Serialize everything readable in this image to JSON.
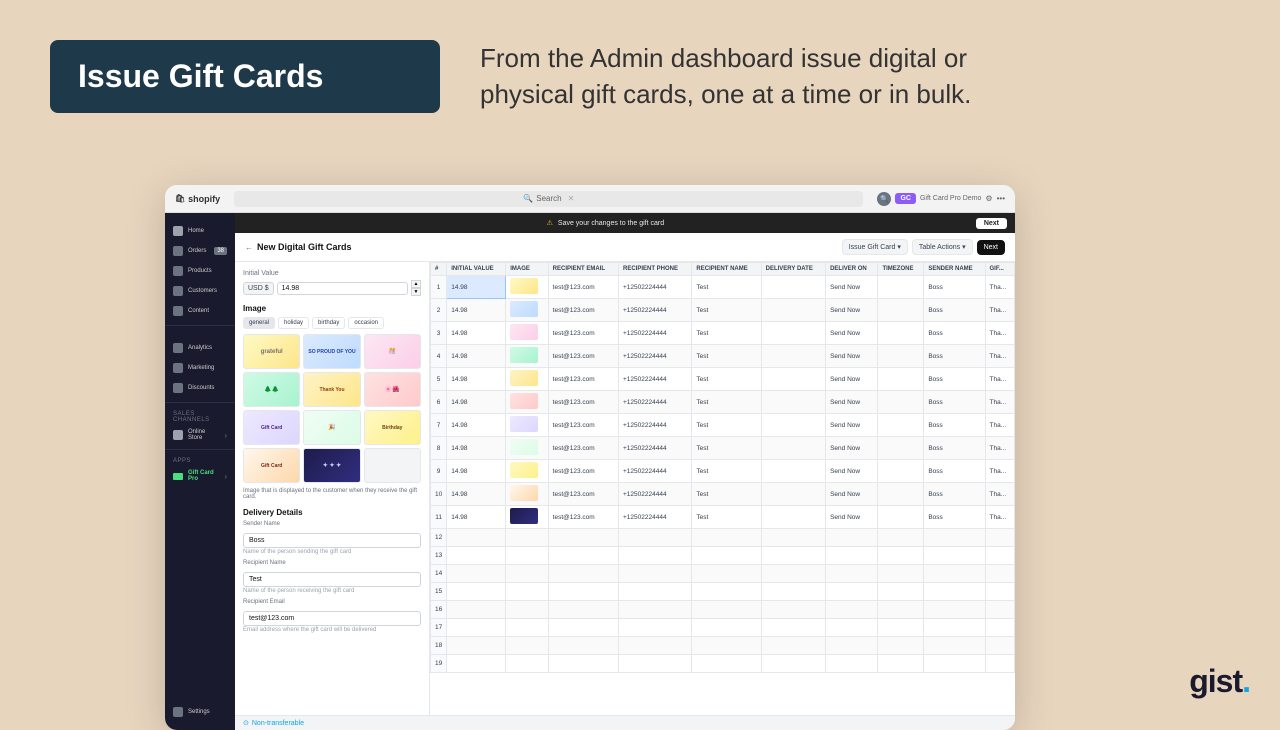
{
  "page": {
    "background_color": "#e8d5be"
  },
  "header": {
    "title": "Issue Gift Cards",
    "subtitle": "From the Admin dashboard issue digital\nor physical gift cards, one at a time or in bulk."
  },
  "browser": {
    "address_bar_text": "Search",
    "store_name": "Gift Card Pro Demo"
  },
  "sidebar": {
    "items": [
      {
        "label": "Home",
        "icon": "home-icon"
      },
      {
        "label": "Orders",
        "icon": "orders-icon",
        "badge": "38"
      },
      {
        "label": "Products",
        "icon": "products-icon"
      },
      {
        "label": "Customers",
        "icon": "customers-icon"
      },
      {
        "label": "Content",
        "icon": "content-icon"
      }
    ],
    "analytics_items": [
      {
        "label": "Analytics"
      },
      {
        "label": "Marketing"
      },
      {
        "label": "Discounts"
      }
    ],
    "sales_channels": {
      "label": "Sales channels",
      "items": [
        {
          "label": "Online Store"
        }
      ]
    },
    "apps": {
      "label": "Apps",
      "items": [
        {
          "label": "Gift Card Pro",
          "active": true
        }
      ]
    },
    "bottom_items": [
      {
        "label": "Settings"
      }
    ]
  },
  "top_bar": {
    "save_notice": "Save your changes to the gift card",
    "next_button": "Next"
  },
  "page_content": {
    "back_label": "←",
    "page_title": "New Digital Gift Cards",
    "actions": [
      {
        "label": "Issue Gift Card ▾"
      },
      {
        "label": "Table Actions ▾"
      },
      {
        "label": "Next",
        "primary": true
      }
    ]
  },
  "left_panel": {
    "initial_value_label": "Initial Value",
    "currency": "USD $",
    "initial_value": "14.98",
    "image_section_label": "Image",
    "image_tabs": [
      "general",
      "holiday",
      "birthday",
      "occasion"
    ],
    "image_cards": [
      {
        "label": "grateful",
        "style": "grateful"
      },
      {
        "label": "SO PROUD OF YOU",
        "style": "proud"
      },
      {
        "label": "🎊",
        "style": "congrats"
      },
      {
        "label": "🌲🌲",
        "style": "trees"
      },
      {
        "label": "Thank You",
        "style": "thankyou"
      },
      {
        "label": "🌸🌺",
        "style": "flowers"
      },
      {
        "label": "Gift Card",
        "style": "giftcard"
      },
      {
        "label": "🎉",
        "style": "dots"
      },
      {
        "label": "Birthday",
        "style": "birthday"
      },
      {
        "label": "Gift Card",
        "style": "giftcard2"
      },
      {
        "label": "✦ ✦ ✦",
        "style": "dark-dots"
      },
      {
        "label": "",
        "style": ""
      }
    ],
    "image_description": "Image that is displayed to the customer when they receive the gift card.",
    "delivery_section_label": "Delivery Details",
    "fields": [
      {
        "label": "Sender Name",
        "value": "Boss",
        "hint": "Name of the person sending the gift card"
      },
      {
        "label": "Recipient Name",
        "value": "Test",
        "hint": "Name of the person receiving the gift card"
      },
      {
        "label": "Recipient Email",
        "value": "test@123.com",
        "hint": "Email address where the gift card will be delivered"
      }
    ]
  },
  "spreadsheet": {
    "headers": [
      "#",
      "INITIAL VALUE",
      "IMAGE",
      "RECIPIENT EMAIL",
      "RECIPIENT PHONE",
      "RECIPIENT NAME",
      "DELIVERY DATE",
      "DELIVER ON",
      "TIMEZONE",
      "SENDER NAME",
      "GIF..."
    ],
    "rows": [
      {
        "num": 1,
        "value": "14.98",
        "email": "test@123.com",
        "phone": "+12502224444",
        "name": "Test",
        "deliver_on": "Send Now",
        "sender": "Boss",
        "gift": "Tha..."
      },
      {
        "num": 2,
        "value": "14.98",
        "email": "test@123.com",
        "phone": "+12502224444",
        "name": "Test",
        "deliver_on": "Send Now",
        "sender": "Boss",
        "gift": "Tha..."
      },
      {
        "num": 3,
        "value": "14.98",
        "email": "test@123.com",
        "phone": "+12502224444",
        "name": "Test",
        "deliver_on": "Send Now",
        "sender": "Boss",
        "gift": "Tha..."
      },
      {
        "num": 4,
        "value": "14.98",
        "email": "test@123.com",
        "phone": "+12502224444",
        "name": "Test",
        "deliver_on": "Send Now",
        "sender": "Boss",
        "gift": "Tha..."
      },
      {
        "num": 5,
        "value": "14.98",
        "email": "test@123.com",
        "phone": "+12502224444",
        "name": "Test",
        "deliver_on": "Send Now",
        "sender": "Boss",
        "gift": "Tha..."
      },
      {
        "num": 6,
        "value": "14.98",
        "email": "test@123.com",
        "phone": "+12502224444",
        "name": "Test",
        "deliver_on": "Send Now",
        "sender": "Boss",
        "gift": "Tha..."
      },
      {
        "num": 7,
        "value": "14.98",
        "email": "test@123.com",
        "phone": "+12502224444",
        "name": "Test",
        "deliver_on": "Send Now",
        "sender": "Boss",
        "gift": "Tha..."
      },
      {
        "num": 8,
        "value": "14.98",
        "email": "test@123.com",
        "phone": "+12502224444",
        "name": "Test",
        "deliver_on": "Send Now",
        "sender": "Boss",
        "gift": "Tha..."
      },
      {
        "num": 9,
        "value": "14.98",
        "email": "test@123.com",
        "phone": "+12502224444",
        "name": "Test",
        "deliver_on": "Send Now",
        "sender": "Boss",
        "gift": "Tha..."
      },
      {
        "num": 10,
        "value": "14.98",
        "email": "test@123.com",
        "phone": "+12502224444",
        "name": "Test",
        "deliver_on": "Send Now",
        "sender": "Boss",
        "gift": "Tha..."
      },
      {
        "num": 11,
        "value": "14.98",
        "email": "test@123.com",
        "phone": "+12502224444",
        "name": "Test",
        "deliver_on": "Send Now",
        "sender": "Boss",
        "gift": "Tha..."
      },
      {
        "num": 12,
        "value": "",
        "email": "",
        "phone": "",
        "name": "",
        "deliver_on": "",
        "sender": "",
        "gift": ""
      },
      {
        "num": 13,
        "value": "",
        "email": "",
        "phone": "",
        "name": "",
        "deliver_on": "",
        "sender": "",
        "gift": ""
      },
      {
        "num": 14,
        "value": "",
        "email": "",
        "phone": "",
        "name": "",
        "deliver_on": "",
        "sender": "",
        "gift": ""
      },
      {
        "num": 15,
        "value": "",
        "email": "",
        "phone": "",
        "name": "",
        "deliver_on": "",
        "sender": "",
        "gift": ""
      },
      {
        "num": 16,
        "value": "",
        "email": "",
        "phone": "",
        "name": "",
        "deliver_on": "",
        "sender": "",
        "gift": ""
      },
      {
        "num": 17,
        "value": "",
        "email": "",
        "phone": "",
        "name": "",
        "deliver_on": "",
        "sender": "",
        "gift": ""
      },
      {
        "num": 18,
        "value": "",
        "email": "",
        "phone": "",
        "name": "",
        "deliver_on": "",
        "sender": "",
        "gift": ""
      },
      {
        "num": 19,
        "value": "",
        "email": "",
        "phone": "",
        "name": "",
        "deliver_on": "",
        "sender": "",
        "gift": ""
      }
    ]
  },
  "bottom_bar": {
    "non_transferable_label": "⊙ Non-transferable"
  },
  "gist": {
    "logo_text": "gist",
    "dot_text": "."
  }
}
